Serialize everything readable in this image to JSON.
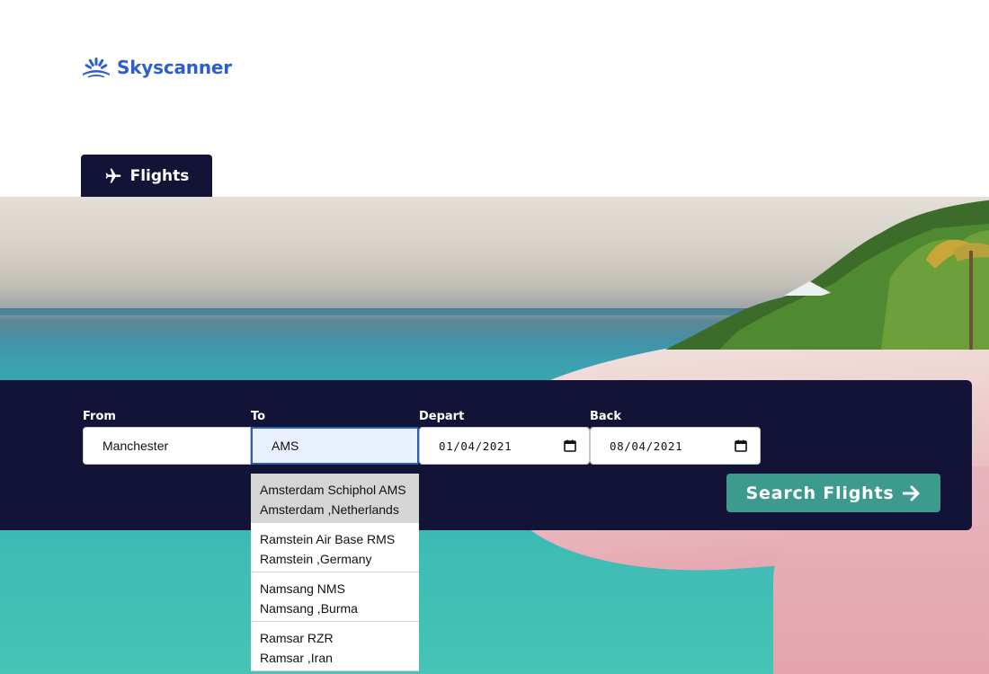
{
  "brand": {
    "name": "Skyscanner",
    "color": "#2c5dd1",
    "icon": "sunrise-logo-icon"
  },
  "tabs": [
    {
      "label": "Flights",
      "icon": "airplane-icon",
      "active": true
    }
  ],
  "search": {
    "from": {
      "label": "From",
      "value": "Manchester"
    },
    "to": {
      "label": "To",
      "value": "AMS"
    },
    "depart": {
      "label": "Depart",
      "value": "01/04/2021",
      "icon": "calendar-icon"
    },
    "back": {
      "label": "Back",
      "value": "08/04/2021",
      "icon": "calendar-icon"
    },
    "button_label": "Search Flights",
    "button_icon": "arrow-right-icon",
    "button_color": "#3d9a8f"
  },
  "suggestions": [
    {
      "line1": "Amsterdam Schiphol AMS",
      "line2": "Amsterdam ,Netherlands",
      "highlighted": true
    },
    {
      "line1": "Ramstein Air Base RMS",
      "line2": "Ramstein ,Germany"
    },
    {
      "line1": "Namsang NMS",
      "line2": "Namsang ,Burma"
    },
    {
      "line1": "Ramsar RZR",
      "line2": "Ramsar ,Iran"
    }
  ],
  "colors": {
    "panel": "#131338",
    "tab": "#131338"
  }
}
